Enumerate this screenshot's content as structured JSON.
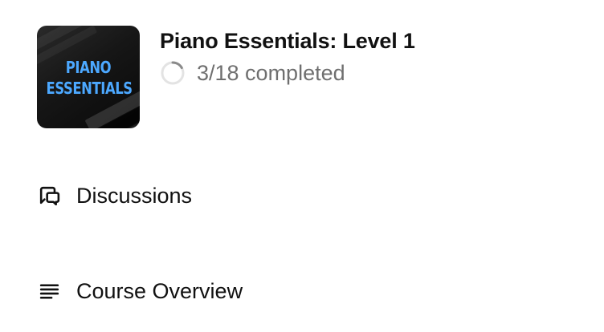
{
  "course": {
    "thumbnail_text": "PIANO ESSENTIALS",
    "title": "Piano Essentials: Level 1",
    "progress": {
      "completed": 3,
      "total": 18,
      "label": "3/18 completed"
    }
  },
  "menu": {
    "items": [
      {
        "label": "Discussions",
        "icon": "discussions-icon"
      },
      {
        "label": "Course Overview",
        "icon": "list-icon"
      }
    ]
  },
  "colors": {
    "thumbnail_text": "#4ca8ff",
    "title": "#111111",
    "progress_text": "#6f6f6f",
    "progress_track": "#e3e3e3",
    "progress_fill": "#8a8a8a"
  }
}
